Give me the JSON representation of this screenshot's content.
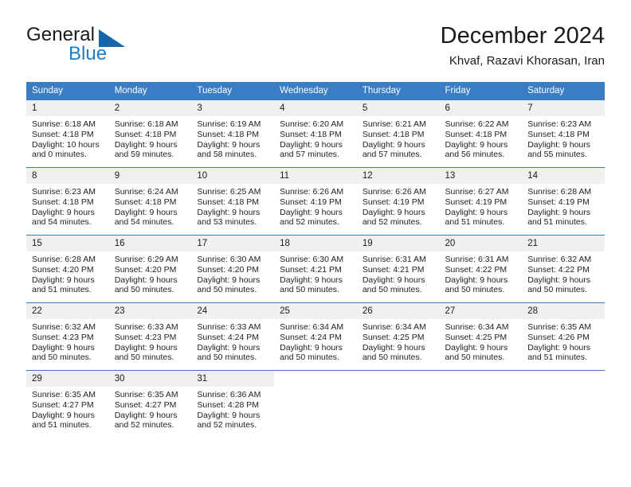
{
  "brand": {
    "name_part1": "General",
    "name_part2": "Blue",
    "accent_color": "#1d7dc4",
    "triangle_color": "#1566ab"
  },
  "header": {
    "title": "December 2024",
    "subtitle": "Khvaf, Razavi Khorasan, Iran"
  },
  "calendar": {
    "header_bg": "#3a7dc4",
    "daynum_bg": "#f0f0f0",
    "weekdays": [
      "Sunday",
      "Monday",
      "Tuesday",
      "Wednesday",
      "Thursday",
      "Friday",
      "Saturday"
    ],
    "weeks": [
      [
        {
          "day": "1",
          "sunrise": "Sunrise: 6:18 AM",
          "sunset": "Sunset: 4:18 PM",
          "daylight1": "Daylight: 10 hours",
          "daylight2": "and 0 minutes."
        },
        {
          "day": "2",
          "sunrise": "Sunrise: 6:18 AM",
          "sunset": "Sunset: 4:18 PM",
          "daylight1": "Daylight: 9 hours",
          "daylight2": "and 59 minutes."
        },
        {
          "day": "3",
          "sunrise": "Sunrise: 6:19 AM",
          "sunset": "Sunset: 4:18 PM",
          "daylight1": "Daylight: 9 hours",
          "daylight2": "and 58 minutes."
        },
        {
          "day": "4",
          "sunrise": "Sunrise: 6:20 AM",
          "sunset": "Sunset: 4:18 PM",
          "daylight1": "Daylight: 9 hours",
          "daylight2": "and 57 minutes."
        },
        {
          "day": "5",
          "sunrise": "Sunrise: 6:21 AM",
          "sunset": "Sunset: 4:18 PM",
          "daylight1": "Daylight: 9 hours",
          "daylight2": "and 57 minutes."
        },
        {
          "day": "6",
          "sunrise": "Sunrise: 6:22 AM",
          "sunset": "Sunset: 4:18 PM",
          "daylight1": "Daylight: 9 hours",
          "daylight2": "and 56 minutes."
        },
        {
          "day": "7",
          "sunrise": "Sunrise: 6:23 AM",
          "sunset": "Sunset: 4:18 PM",
          "daylight1": "Daylight: 9 hours",
          "daylight2": "and 55 minutes."
        }
      ],
      [
        {
          "day": "8",
          "sunrise": "Sunrise: 6:23 AM",
          "sunset": "Sunset: 4:18 PM",
          "daylight1": "Daylight: 9 hours",
          "daylight2": "and 54 minutes."
        },
        {
          "day": "9",
          "sunrise": "Sunrise: 6:24 AM",
          "sunset": "Sunset: 4:18 PM",
          "daylight1": "Daylight: 9 hours",
          "daylight2": "and 54 minutes."
        },
        {
          "day": "10",
          "sunrise": "Sunrise: 6:25 AM",
          "sunset": "Sunset: 4:18 PM",
          "daylight1": "Daylight: 9 hours",
          "daylight2": "and 53 minutes."
        },
        {
          "day": "11",
          "sunrise": "Sunrise: 6:26 AM",
          "sunset": "Sunset: 4:19 PM",
          "daylight1": "Daylight: 9 hours",
          "daylight2": "and 52 minutes."
        },
        {
          "day": "12",
          "sunrise": "Sunrise: 6:26 AM",
          "sunset": "Sunset: 4:19 PM",
          "daylight1": "Daylight: 9 hours",
          "daylight2": "and 52 minutes."
        },
        {
          "day": "13",
          "sunrise": "Sunrise: 6:27 AM",
          "sunset": "Sunset: 4:19 PM",
          "daylight1": "Daylight: 9 hours",
          "daylight2": "and 51 minutes."
        },
        {
          "day": "14",
          "sunrise": "Sunrise: 6:28 AM",
          "sunset": "Sunset: 4:19 PM",
          "daylight1": "Daylight: 9 hours",
          "daylight2": "and 51 minutes."
        }
      ],
      [
        {
          "day": "15",
          "sunrise": "Sunrise: 6:28 AM",
          "sunset": "Sunset: 4:20 PM",
          "daylight1": "Daylight: 9 hours",
          "daylight2": "and 51 minutes."
        },
        {
          "day": "16",
          "sunrise": "Sunrise: 6:29 AM",
          "sunset": "Sunset: 4:20 PM",
          "daylight1": "Daylight: 9 hours",
          "daylight2": "and 50 minutes."
        },
        {
          "day": "17",
          "sunrise": "Sunrise: 6:30 AM",
          "sunset": "Sunset: 4:20 PM",
          "daylight1": "Daylight: 9 hours",
          "daylight2": "and 50 minutes."
        },
        {
          "day": "18",
          "sunrise": "Sunrise: 6:30 AM",
          "sunset": "Sunset: 4:21 PM",
          "daylight1": "Daylight: 9 hours",
          "daylight2": "and 50 minutes."
        },
        {
          "day": "19",
          "sunrise": "Sunrise: 6:31 AM",
          "sunset": "Sunset: 4:21 PM",
          "daylight1": "Daylight: 9 hours",
          "daylight2": "and 50 minutes."
        },
        {
          "day": "20",
          "sunrise": "Sunrise: 6:31 AM",
          "sunset": "Sunset: 4:22 PM",
          "daylight1": "Daylight: 9 hours",
          "daylight2": "and 50 minutes."
        },
        {
          "day": "21",
          "sunrise": "Sunrise: 6:32 AM",
          "sunset": "Sunset: 4:22 PM",
          "daylight1": "Daylight: 9 hours",
          "daylight2": "and 50 minutes."
        }
      ],
      [
        {
          "day": "22",
          "sunrise": "Sunrise: 6:32 AM",
          "sunset": "Sunset: 4:23 PM",
          "daylight1": "Daylight: 9 hours",
          "daylight2": "and 50 minutes."
        },
        {
          "day": "23",
          "sunrise": "Sunrise: 6:33 AM",
          "sunset": "Sunset: 4:23 PM",
          "daylight1": "Daylight: 9 hours",
          "daylight2": "and 50 minutes."
        },
        {
          "day": "24",
          "sunrise": "Sunrise: 6:33 AM",
          "sunset": "Sunset: 4:24 PM",
          "daylight1": "Daylight: 9 hours",
          "daylight2": "and 50 minutes."
        },
        {
          "day": "25",
          "sunrise": "Sunrise: 6:34 AM",
          "sunset": "Sunset: 4:24 PM",
          "daylight1": "Daylight: 9 hours",
          "daylight2": "and 50 minutes."
        },
        {
          "day": "26",
          "sunrise": "Sunrise: 6:34 AM",
          "sunset": "Sunset: 4:25 PM",
          "daylight1": "Daylight: 9 hours",
          "daylight2": "and 50 minutes."
        },
        {
          "day": "27",
          "sunrise": "Sunrise: 6:34 AM",
          "sunset": "Sunset: 4:25 PM",
          "daylight1": "Daylight: 9 hours",
          "daylight2": "and 50 minutes."
        },
        {
          "day": "28",
          "sunrise": "Sunrise: 6:35 AM",
          "sunset": "Sunset: 4:26 PM",
          "daylight1": "Daylight: 9 hours",
          "daylight2": "and 51 minutes."
        }
      ],
      [
        {
          "day": "29",
          "sunrise": "Sunrise: 6:35 AM",
          "sunset": "Sunset: 4:27 PM",
          "daylight1": "Daylight: 9 hours",
          "daylight2": "and 51 minutes."
        },
        {
          "day": "30",
          "sunrise": "Sunrise: 6:35 AM",
          "sunset": "Sunset: 4:27 PM",
          "daylight1": "Daylight: 9 hours",
          "daylight2": "and 52 minutes."
        },
        {
          "day": "31",
          "sunrise": "Sunrise: 6:36 AM",
          "sunset": "Sunset: 4:28 PM",
          "daylight1": "Daylight: 9 hours",
          "daylight2": "and 52 minutes."
        },
        {
          "day": "",
          "sunrise": "",
          "sunset": "",
          "daylight1": "",
          "daylight2": ""
        },
        {
          "day": "",
          "sunrise": "",
          "sunset": "",
          "daylight1": "",
          "daylight2": ""
        },
        {
          "day": "",
          "sunrise": "",
          "sunset": "",
          "daylight1": "",
          "daylight2": ""
        },
        {
          "day": "",
          "sunrise": "",
          "sunset": "",
          "daylight1": "",
          "daylight2": ""
        }
      ]
    ]
  }
}
